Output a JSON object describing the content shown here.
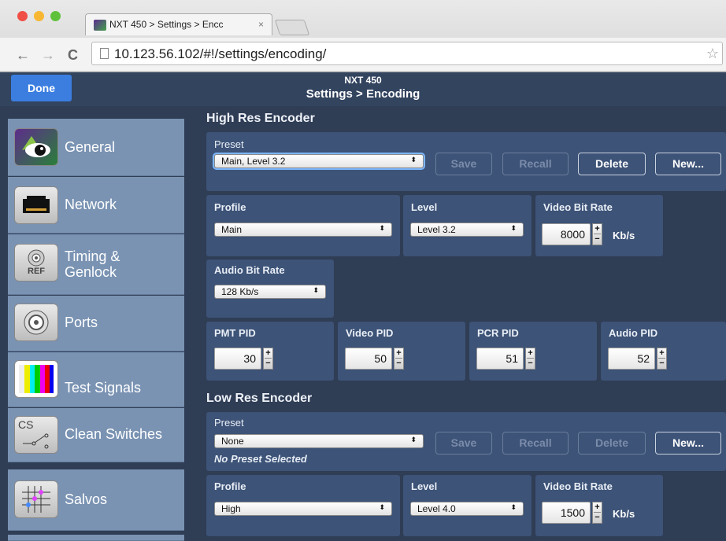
{
  "browser": {
    "tab_title": "NXT 450 > Settings > Encc",
    "tab_close": "×",
    "url": "10.123.56.102/#!/settings/encoding/",
    "back": "←",
    "forward": "→",
    "reload": "C",
    "star": "☆",
    "lights": [
      "#f04f45",
      "#f7b733",
      "#5fc13b"
    ]
  },
  "header": {
    "done": "Done",
    "device": "NXT 450",
    "title": "Settings > Encoding"
  },
  "sidebar": {
    "items": [
      {
        "label": "General",
        "icon": "eye-logo-icon"
      },
      {
        "label": "Network",
        "icon": "ethernet-port-icon"
      },
      {
        "label": "Timing &",
        "label2": "Genlock",
        "badge": "REF",
        "icon": "ref-connector-icon"
      },
      {
        "label": "Ports",
        "icon": "bnc-connector-icon"
      },
      {
        "label": "Test Signals",
        "icon": "color-bars-icon"
      },
      {
        "label": "Clean Switches",
        "badge": "CS",
        "icon": "switch-icon"
      },
      {
        "label": "Salvos",
        "icon": "crosspoint-grid-icon"
      }
    ]
  },
  "high": {
    "heading": "High Res Encoder",
    "preset_label": "Preset",
    "preset_value": "Main, Level 3.2",
    "save": "Save",
    "recall": "Recall",
    "delete": "Delete",
    "new": "New...",
    "profile_label": "Profile",
    "profile_value": "Main",
    "level_label": "Level",
    "level_value": "Level 3.2",
    "vbr_label": "Video Bit Rate",
    "vbr_value": "8000",
    "vbr_unit": "Kb/s",
    "abr_label": "Audio Bit Rate",
    "abr_value": "128 Kb/s",
    "pmt_label": "PMT PID",
    "pmt_value": "30",
    "vpid_label": "Video PID",
    "vpid_value": "50",
    "pcr_label": "PCR PID",
    "pcr_value": "51",
    "apid_label": "Audio PID",
    "apid_value": "52"
  },
  "low": {
    "heading": "Low Res Encoder",
    "preset_label": "Preset",
    "preset_value": "None",
    "preset_note": "No Preset Selected",
    "save": "Save",
    "recall": "Recall",
    "delete": "Delete",
    "new": "New...",
    "profile_label": "Profile",
    "profile_value": "High",
    "level_label": "Level",
    "level_value": "Level 4.0",
    "vbr_label": "Video Bit Rate",
    "vbr_value": "1500",
    "vbr_unit": "Kb/s"
  },
  "symbols": {
    "select_arrow": "⬍",
    "plus": "+",
    "minus": "−"
  }
}
